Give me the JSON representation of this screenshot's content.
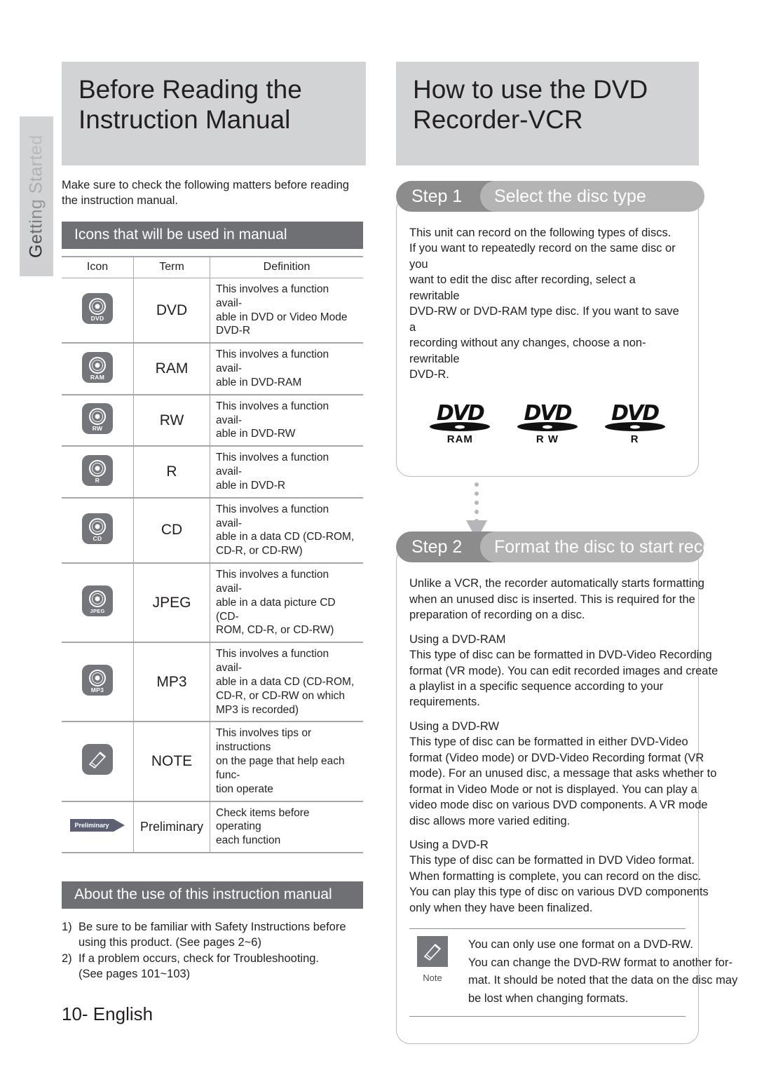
{
  "sidebar": {
    "tab_label": "Getting Started"
  },
  "footer": {
    "page": "10- English"
  },
  "left": {
    "banner_line1": "Before Reading the",
    "banner_line2": "Instruction Manual",
    "intro_line1": "Make sure to check the following matters before reading",
    "intro_line2": "the instruction manual.",
    "section_icons_title": "Icons that will be used in manual",
    "table": {
      "headers": [
        "Icon",
        "Term",
        "Definition"
      ],
      "rows": [
        {
          "icon_name": "dvd-disc-icon",
          "icon_label": "DVD",
          "term": "DVD",
          "definition": [
            "This involves a function avail-",
            "able in DVD or Video Mode",
            "DVD-R"
          ]
        },
        {
          "icon_name": "ram-disc-icon",
          "icon_label": "RAM",
          "term": "RAM",
          "definition": [
            "This involves a function avail-",
            "able in DVD-RAM"
          ]
        },
        {
          "icon_name": "rw-disc-icon",
          "icon_label": "RW",
          "term": "RW",
          "definition": [
            "This involves a function avail-",
            "able in DVD-RW"
          ]
        },
        {
          "icon_name": "r-disc-icon",
          "icon_label": "R",
          "term": "R",
          "definition": [
            "This involves a function avail-",
            "able in DVD-R"
          ]
        },
        {
          "icon_name": "cd-disc-icon",
          "icon_label": "CD",
          "term": "CD",
          "definition": [
            "This involves a function avail-",
            "able in a data CD (CD-ROM,",
            "CD-R, or CD-RW)"
          ]
        },
        {
          "icon_name": "jpeg-disc-icon",
          "icon_label": "JPEG",
          "term": "JPEG",
          "definition": [
            "This involves a function avail-",
            "able in a data picture CD (CD-",
            "ROM, CD-R, or CD-RW)"
          ]
        },
        {
          "icon_name": "mp3-disc-icon",
          "icon_label": "MP3",
          "term": "MP3",
          "definition": [
            "This involves a function avail-",
            "able in a data CD (CD-ROM,",
            "CD-R, or CD-RW on which",
            "MP3 is recorded)"
          ]
        },
        {
          "icon_name": "note-pencil-icon",
          "icon_label": "",
          "term": "NOTE",
          "definition": [
            "This involves tips or instructions",
            "on the page that help each func-",
            "tion operate"
          ]
        },
        {
          "icon_name": "preliminary-banner-icon",
          "icon_label": "Preliminary",
          "term": "Preliminary",
          "definition": [
            "Check items before operating",
            "each function"
          ]
        }
      ]
    },
    "section_about_title": "About the use of this instruction manual",
    "list": [
      {
        "num": "1)",
        "lines": [
          "Be sure to be familiar with Safety Instructions before",
          "using this product. (See pages 2~6)"
        ]
      },
      {
        "num": "2)",
        "lines": [
          "If a problem occurs, check for Troubleshooting.",
          "(See pages 101~103)"
        ]
      }
    ]
  },
  "right": {
    "banner_line1": "How to use the DVD",
    "banner_line2": "Recorder-VCR",
    "step1": {
      "num": "Step 1",
      "title": "Select the disc type",
      "body": [
        "This unit can record on the following types of discs.",
        "If you want to repeatedly record on the same disc or you",
        "want to edit the disc after recording, select a rewritable",
        "DVD-RW or DVD-RAM type disc. If you want to save a",
        "recording without any changes, choose a non-rewritable",
        "DVD-R."
      ],
      "logos": [
        {
          "glyph": "DVD",
          "label": "RAM"
        },
        {
          "glyph": "DVD",
          "label": "R W"
        },
        {
          "glyph": "DVD",
          "label": "R"
        }
      ]
    },
    "step2": {
      "num": "Step 2",
      "title": "Format the disc to start recording",
      "body": [
        "Unlike a VCR, the recorder automatically starts formatting",
        "when an unused disc is inserted. This is required for the",
        "preparation of recording on a disc."
      ],
      "sub1_heading": "Using a DVD-RAM",
      "sub1_body": [
        "This type of disc can be formatted in DVD-Video Recording",
        "format (VR mode). You can edit recorded images and create",
        "a playlist in a specific sequence according to your",
        "requirements."
      ],
      "sub2_heading": "Using a DVD-RW",
      "sub2_body": [
        "This type of disc can be formatted in either DVD-Video",
        "format (Video mode) or DVD-Video Recording format (VR",
        "mode). For an unused disc, a message that asks whether to",
        "format in Video Mode or not is displayed. You can play a",
        "video mode disc on various DVD components. A VR mode",
        "disc allows more varied editing."
      ],
      "sub3_heading": "Using a DVD-R",
      "sub3_body": [
        "This type of disc can be formatted in DVD Video format.",
        "When formatting is complete, you can record on the disc.",
        "You can play this type of disc on various DVD components",
        "only when they have been finalized."
      ],
      "note": {
        "caption": "Note",
        "lines": [
          "You can only use one format on a DVD-RW.",
          "You can change the DVD-RW format to another for-",
          "mat. It should be noted that the data on the disc may",
          "be lost when changing formats."
        ]
      }
    }
  },
  "colors": {
    "banner_gray": "#d2d3d5",
    "section_bar_gray": "#6f7073",
    "icon_gray": "#74767c",
    "step_outer_gray": "#8c8c8c",
    "step_inner_gray": "#b4b4b4",
    "preliminary_blue": "#5d5f72"
  }
}
